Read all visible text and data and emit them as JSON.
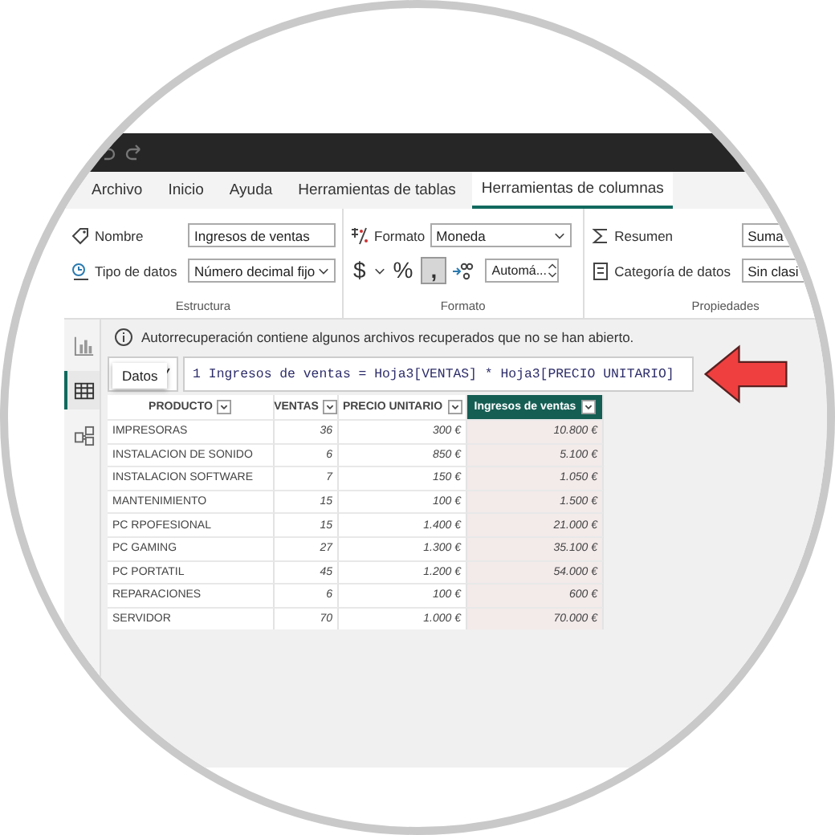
{
  "tabs": [
    {
      "label": "Archivo",
      "selected": false
    },
    {
      "label": "Inicio",
      "selected": false
    },
    {
      "label": "Ayuda",
      "selected": false
    },
    {
      "label": "Herramientas de tablas",
      "selected": false
    },
    {
      "label": "Herramientas de columnas",
      "selected": true
    }
  ],
  "ribbon": {
    "groups": [
      {
        "label": "Estructura",
        "kind": "estructura",
        "name_label": "Nombre",
        "name_value": "Ingresos de ventas",
        "type_label": "Tipo de datos",
        "type_value": "Número decimal fijo"
      },
      {
        "label": "Formato",
        "kind": "formato",
        "format_label": "Formato",
        "format_value": "Moneda",
        "currency_symbol": "$",
        "percent_symbol": "%",
        "comma_symbol": ",",
        "comma_on": true,
        "decimals_value": "Automá..."
      },
      {
        "label": "Propiedades",
        "kind": "propiedades",
        "summary_label": "Resumen",
        "summary_value": "Suma",
        "category_label": "Categoría de datos",
        "category_value": "Sin clasi"
      }
    ]
  },
  "sidebar": {
    "views": [
      {
        "kind": "report",
        "selected": false
      },
      {
        "kind": "table",
        "selected": true
      },
      {
        "kind": "model",
        "selected": false
      }
    ],
    "tooltip": "Datos"
  },
  "info_bar": {
    "message": "Autorrecuperación contiene algunos archivos recuperados que no se han abierto."
  },
  "formula_bar": {
    "line": "1",
    "formula": "Ingresos de ventas = Hoja3[VENTAS] * Hoja3[PRECIO UNITARIO]"
  },
  "table": {
    "columns": [
      {
        "label": "PRODUCTO",
        "selected": false
      },
      {
        "label": "VENTAS",
        "selected": false
      },
      {
        "label": "PRECIO UNITARIO",
        "selected": false
      },
      {
        "label": "Ingresos de ventas",
        "selected": true
      }
    ],
    "rows": [
      [
        "IMPRESORAS",
        "36",
        "300 €",
        "10.800 €"
      ],
      [
        "INSTALACION DE SONIDO",
        "6",
        "850 €",
        "5.100 €"
      ],
      [
        "INSTALACION SOFTWARE",
        "7",
        "150 €",
        "1.050 €"
      ],
      [
        "MANTENIMIENTO",
        "15",
        "100 €",
        "1.500 €"
      ],
      [
        "PC RPOFESIONAL",
        "15",
        "1.400 €",
        "21.000 €"
      ],
      [
        "PC GAMING",
        "27",
        "1.300 €",
        "35.100 €"
      ],
      [
        "PC PORTATIL",
        "45",
        "1.200 €",
        "54.000 €"
      ],
      [
        "REPARACIONES",
        "6",
        "100 €",
        "600 €"
      ],
      [
        "SERVIDOR",
        "70",
        "1.000 €",
        "70.000 €"
      ]
    ]
  }
}
